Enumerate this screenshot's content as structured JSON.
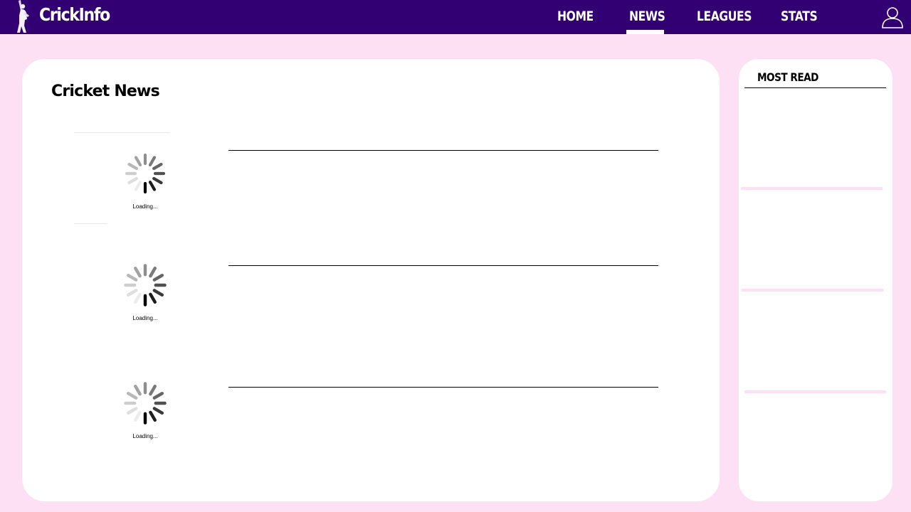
{
  "header": {
    "brand": "CrickInfo",
    "nav": [
      {
        "label": "HOME",
        "active": false
      },
      {
        "label": "NEWS",
        "active": true
      },
      {
        "label": "LEAGUES",
        "active": false
      },
      {
        "label": "STATS",
        "active": false
      }
    ],
    "logo_icon": "batsman-logo-icon",
    "user_icon": "user-profile-icon"
  },
  "main": {
    "title": "Cricket News",
    "items": [
      {
        "loading_text": "Loading..."
      },
      {
        "loading_text": "Loading..."
      },
      {
        "loading_text": "Loading..."
      }
    ]
  },
  "sidebar": {
    "title": "MOST READ"
  },
  "colors": {
    "header_bg": "#330073",
    "page_bg": "#fde0f3",
    "card_bg": "#ffffff"
  }
}
